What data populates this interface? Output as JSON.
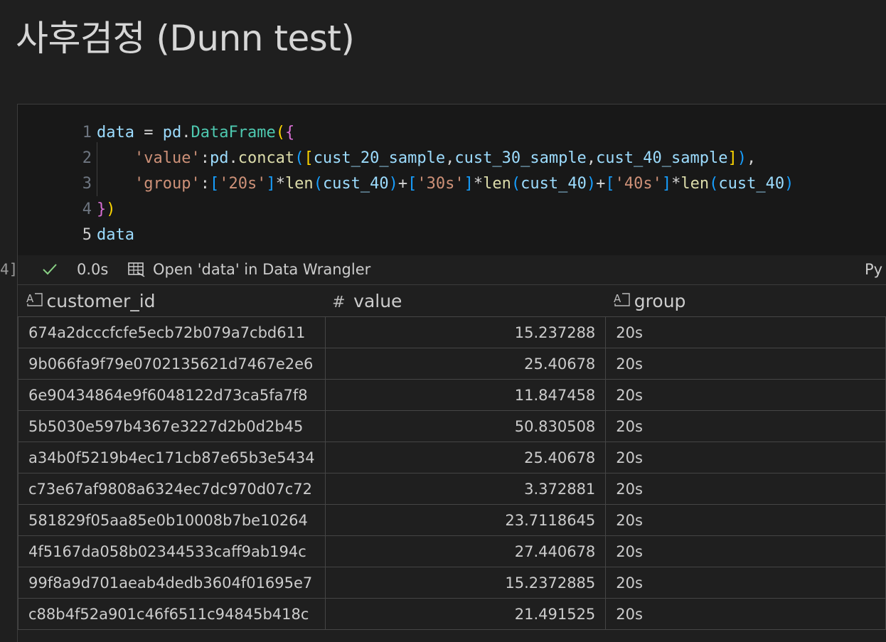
{
  "markdown": {
    "heading": "사후검정 (Dunn test)"
  },
  "cell": {
    "execution_count": "4]",
    "code_lines": [
      {
        "number": "1",
        "active": false,
        "tokens": [
          {
            "t": "data",
            "c": "var"
          },
          {
            "t": " = ",
            "c": "op"
          },
          {
            "t": "pd",
            "c": "var"
          },
          {
            "t": ".",
            "c": "op"
          },
          {
            "t": "DataFrame",
            "c": "cls"
          },
          {
            "t": "(",
            "c": "b1"
          },
          {
            "t": "{",
            "c": "b2"
          }
        ]
      },
      {
        "number": "2",
        "active": false,
        "tokens": [
          {
            "t": "    ",
            "c": "op"
          },
          {
            "t": "'value'",
            "c": "str"
          },
          {
            "t": ":",
            "c": "op"
          },
          {
            "t": "pd",
            "c": "var"
          },
          {
            "t": ".",
            "c": "op"
          },
          {
            "t": "concat",
            "c": "fn"
          },
          {
            "t": "(",
            "c": "b3"
          },
          {
            "t": "[",
            "c": "b1"
          },
          {
            "t": "cust_20_sample",
            "c": "var"
          },
          {
            "t": ",",
            "c": "op"
          },
          {
            "t": "cust_30_sample",
            "c": "var"
          },
          {
            "t": ",",
            "c": "op"
          },
          {
            "t": "cust_40_sample",
            "c": "var"
          },
          {
            "t": "]",
            "c": "b1"
          },
          {
            "t": ")",
            "c": "b3"
          },
          {
            "t": ",",
            "c": "op"
          }
        ]
      },
      {
        "number": "3",
        "active": false,
        "tokens": [
          {
            "t": "    ",
            "c": "op"
          },
          {
            "t": "'group'",
            "c": "str"
          },
          {
            "t": ":",
            "c": "op"
          },
          {
            "t": "[",
            "c": "b3"
          },
          {
            "t": "'20s'",
            "c": "str"
          },
          {
            "t": "]",
            "c": "b3"
          },
          {
            "t": "*",
            "c": "op"
          },
          {
            "t": "len",
            "c": "fn"
          },
          {
            "t": "(",
            "c": "b3"
          },
          {
            "t": "cust_40",
            "c": "var"
          },
          {
            "t": ")",
            "c": "b3"
          },
          {
            "t": "+",
            "c": "op"
          },
          {
            "t": "[",
            "c": "b3"
          },
          {
            "t": "'30s'",
            "c": "str"
          },
          {
            "t": "]",
            "c": "b3"
          },
          {
            "t": "*",
            "c": "op"
          },
          {
            "t": "len",
            "c": "fn"
          },
          {
            "t": "(",
            "c": "b3"
          },
          {
            "t": "cust_40",
            "c": "var"
          },
          {
            "t": ")",
            "c": "b3"
          },
          {
            "t": "+",
            "c": "op"
          },
          {
            "t": "[",
            "c": "b3"
          },
          {
            "t": "'40s'",
            "c": "str"
          },
          {
            "t": "]",
            "c": "b3"
          },
          {
            "t": "*",
            "c": "op"
          },
          {
            "t": "len",
            "c": "fn"
          },
          {
            "t": "(",
            "c": "b3"
          },
          {
            "t": "cust_40",
            "c": "var"
          },
          {
            "t": ")",
            "c": "b3"
          }
        ]
      },
      {
        "number": "4",
        "active": false,
        "tokens": [
          {
            "t": "}",
            "c": "b2"
          },
          {
            "t": ")",
            "c": "b1"
          }
        ]
      },
      {
        "number": "5",
        "active": true,
        "tokens": [
          {
            "t": "data",
            "c": "var"
          }
        ]
      }
    ],
    "status": {
      "check_icon": "check-icon",
      "time": "0.0s",
      "data_wrangler_icon": "table-icon",
      "data_wrangler_label": "Open 'data' in Data Wrangler",
      "kernel_lang": "Py"
    }
  },
  "table": {
    "columns": [
      {
        "icon": "text-type-icon",
        "icon_glyph": "A⃞",
        "label": "customer_id"
      },
      {
        "icon": "number-type-icon",
        "icon_glyph": "#",
        "label": "value"
      },
      {
        "icon": "text-type-icon",
        "icon_glyph": "A⃞",
        "label": "group"
      }
    ],
    "rows": [
      [
        "674a2dcccfcfe5ecb72b079a7cbd611",
        "15.237288",
        "20s"
      ],
      [
        "9b066fa9f79e0702135621d7467e2e6",
        "25.40678",
        "20s"
      ],
      [
        "6e90434864e9f6048122d73ca5fa7f8",
        "11.847458",
        "20s"
      ],
      [
        "5b5030e597b4367e3227d2b0d2b45",
        "50.830508",
        "20s"
      ],
      [
        "a34b0f5219b4ec171cb87e65b3e5434",
        "25.40678",
        "20s"
      ],
      [
        "c73e67af9808a6324ec7dc970d07c72",
        "3.372881",
        "20s"
      ],
      [
        "581829f05aa85e0b10008b7be10264",
        "23.7118645",
        "20s"
      ],
      [
        "4f5167da058b02344533caff9ab194c",
        "27.440678",
        "20s"
      ],
      [
        "99f8a9d701aeab4dedb3604f01695e7",
        "15.2372885",
        "20s"
      ],
      [
        "c88b4f52a901c46f6511c94845b418c",
        "21.491525",
        "20s"
      ]
    ]
  }
}
